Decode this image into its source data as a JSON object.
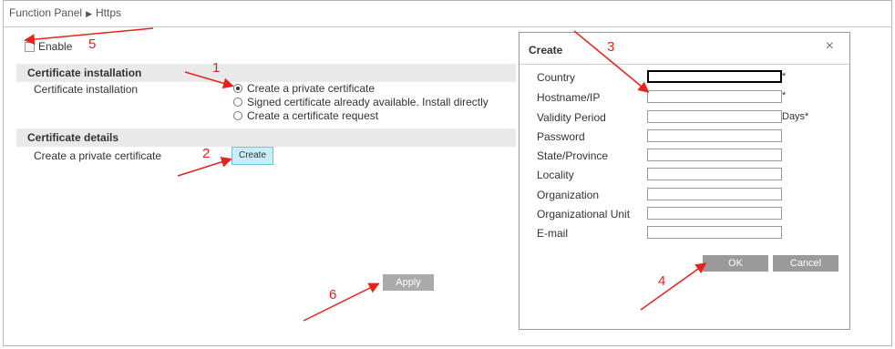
{
  "breadcrumb": {
    "root": "Function Panel",
    "separator": "▶",
    "current": "Https"
  },
  "enable": {
    "label": "Enable",
    "checked": false
  },
  "sections": {
    "install_header": "Certificate installation",
    "install_label": "Certificate installation",
    "details_header": "Certificate details",
    "details_label": "Create a private certificate"
  },
  "install_options": [
    {
      "label": "Create a private certificate",
      "selected": true
    },
    {
      "label": "Signed certificate already available. Install directly",
      "selected": false
    },
    {
      "label": "Create a certificate request",
      "selected": false
    }
  ],
  "buttons": {
    "create": "Create",
    "apply": "Apply"
  },
  "dialog": {
    "title": "Create",
    "close": "×",
    "fields": [
      {
        "label": "Country",
        "suffix": "*",
        "value": ""
      },
      {
        "label": "Hostname/IP",
        "suffix": "*",
        "value": ""
      },
      {
        "label": "Validity Period",
        "suffix": "Days*",
        "value": ""
      },
      {
        "label": "Password",
        "suffix": "",
        "value": ""
      },
      {
        "label": "State/Province",
        "suffix": "",
        "value": ""
      },
      {
        "label": "Locality",
        "suffix": "",
        "value": ""
      },
      {
        "label": "Organization",
        "suffix": "",
        "value": ""
      },
      {
        "label": "Organizational Unit",
        "suffix": "",
        "value": ""
      },
      {
        "label": "E-mail",
        "suffix": "",
        "value": ""
      }
    ],
    "ok": "OK",
    "cancel": "Cancel"
  },
  "annotations": {
    "color": "#e8231e",
    "numbers": [
      "1",
      "2",
      "3",
      "4",
      "5",
      "6"
    ]
  }
}
